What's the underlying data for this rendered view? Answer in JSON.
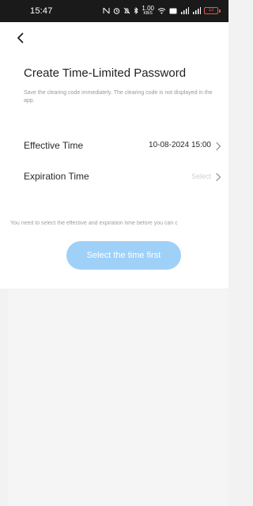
{
  "status_bar": {
    "time": "15:47",
    "speed_value": "1.00",
    "speed_unit": "KB/S",
    "battery": "12"
  },
  "header": {
    "back_icon": "back-chevron-icon",
    "title": "Create Time-Limited Password",
    "subtitle": "Save the clearing code immediately. The clearing code is not displayed in the app."
  },
  "fields": {
    "effective": {
      "label": "Effective Time",
      "value": "10-08-2024 15:00"
    },
    "expiration": {
      "label": "Expiration Time",
      "placeholder": "Select"
    }
  },
  "hint": "You need to select the effective and expiration time before you can c",
  "button": {
    "label": "Select the time first"
  },
  "colors": {
    "accent_disabled": "#9fd0f8",
    "battery_low": "#e2564a"
  }
}
